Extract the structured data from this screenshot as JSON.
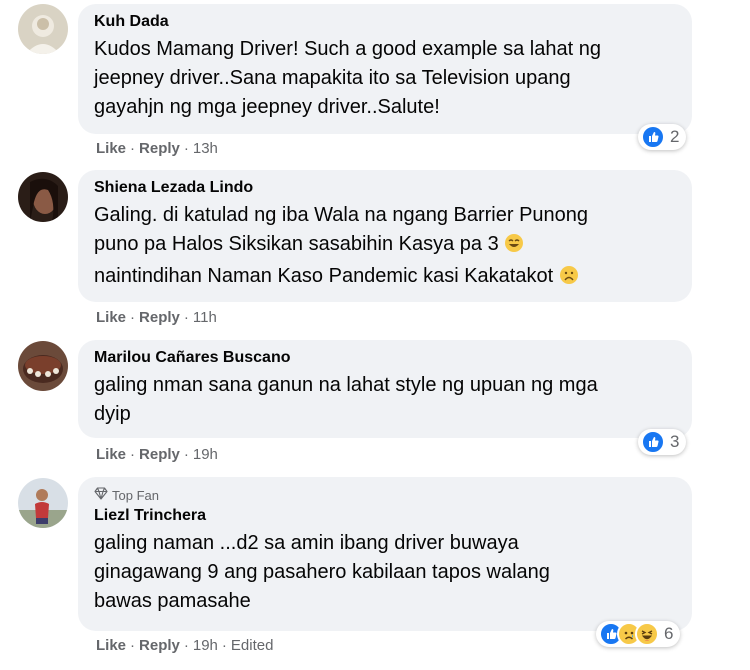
{
  "comments": [
    {
      "author": "Kuh Dada",
      "lines": [
        "Kudos Mamang Driver! Such a good example sa lahat ng",
        "jeepney driver..Sana mapakita ito sa Television upang",
        "gayahjn ng mga jeepney driver..Salute!"
      ],
      "like_label": "Like",
      "reply_label": "Reply",
      "time": "13h",
      "reaction_count": "2",
      "reactions": [
        "like-icon"
      ]
    },
    {
      "author": "Shiena Lezada Lindo",
      "lines": [
        "Galing. di katulad ng iba Wala na ngang Barrier Punong",
        "puno pa Halos Siksikan sasabihin Kasya pa 3",
        "naintindihan Naman Kaso Pandemic kasi Kakatakot"
      ],
      "like_label": "Like",
      "reply_label": "Reply",
      "time": "11h"
    },
    {
      "author": "Marilou Cañares Buscano",
      "lines": [
        "galing nman sana ganun na lahat style ng upuan ng mga",
        "dyip"
      ],
      "like_label": "Like",
      "reply_label": "Reply",
      "time": "19h",
      "reaction_count": "3",
      "reactions": [
        "like-icon"
      ]
    },
    {
      "badge": "Top Fan",
      "author": "Liezl Trinchera",
      "lines": [
        "galing naman ...d2 sa amin ibang driver buwaya",
        "ginagawang 9 ang pasahero kabilaan tapos walang",
        "bawas pamasahe"
      ],
      "like_label": "Like",
      "reply_label": "Reply",
      "time": "19h",
      "edited": "Edited",
      "reaction_count": "6",
      "reactions": [
        "like-icon",
        "sad-icon",
        "haha-icon"
      ]
    }
  ],
  "colors": {
    "bubble": "#f0f2f5",
    "secondary_text": "#65676b",
    "like_blue": "#1877f2"
  }
}
